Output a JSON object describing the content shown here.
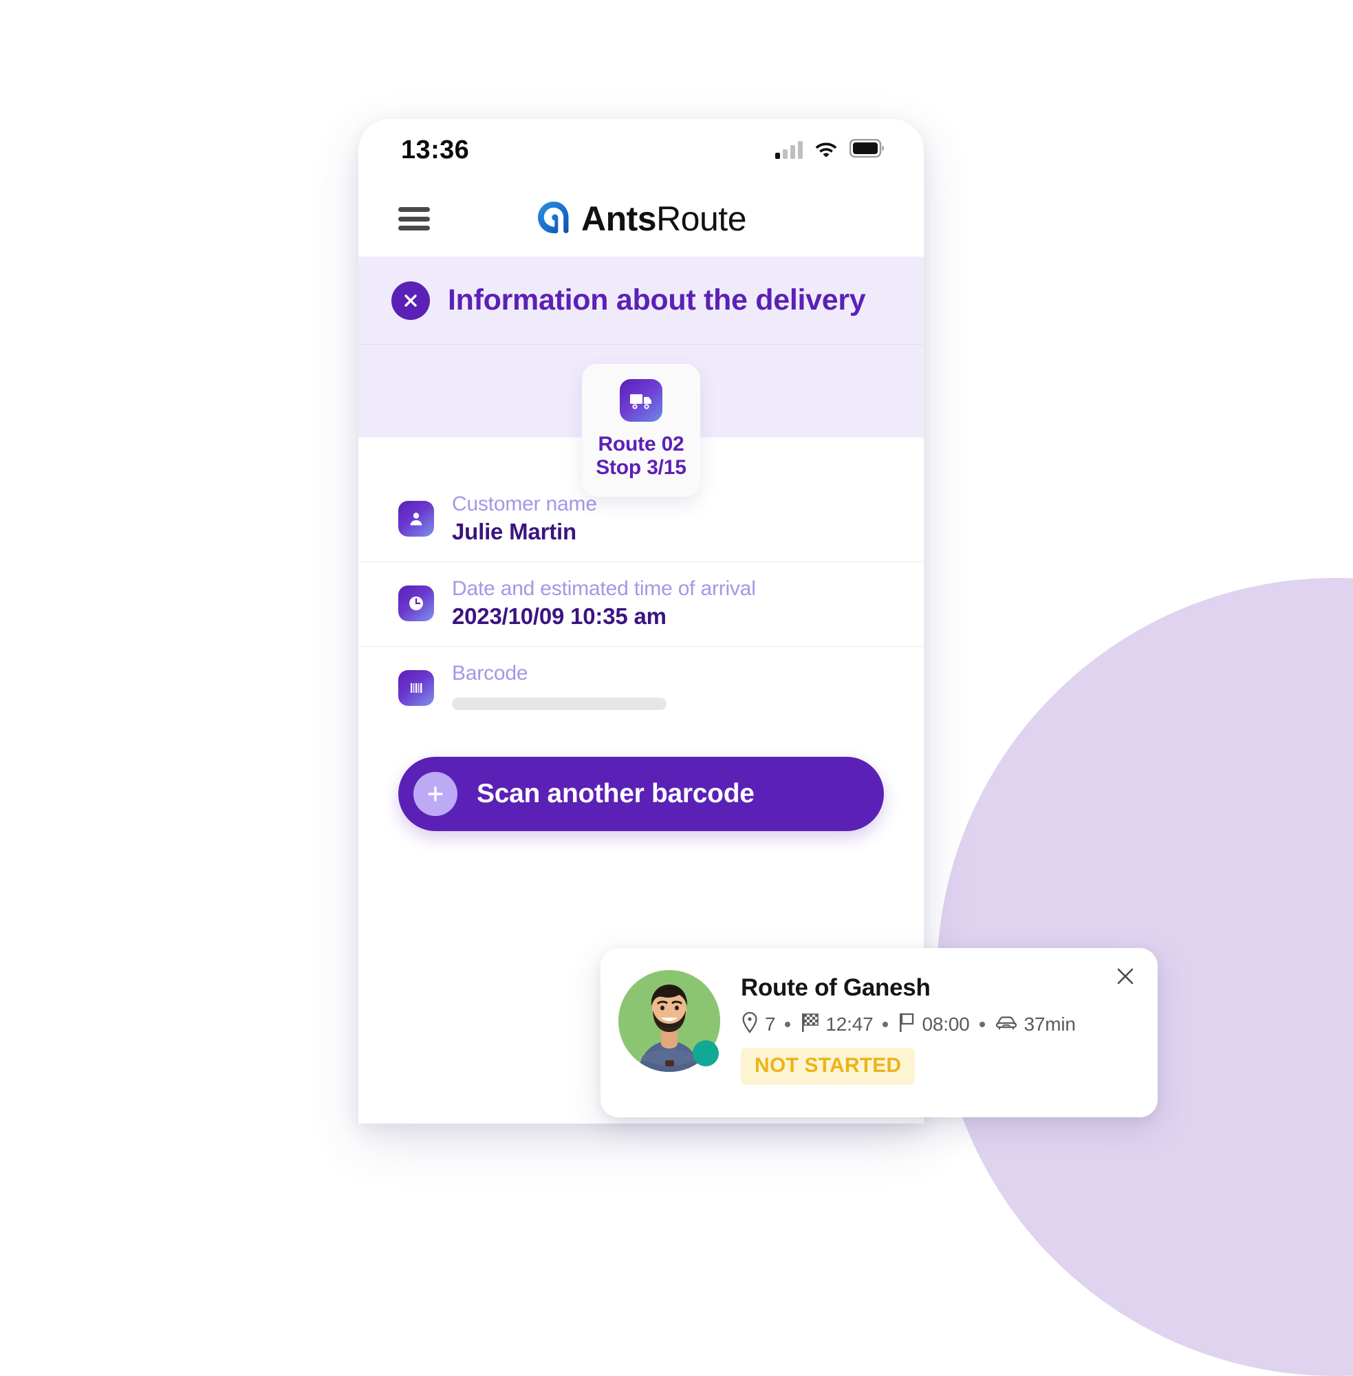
{
  "colors": {
    "brand_purple": "#5b21b6",
    "lavender_bg": "#f0ebfb",
    "label_purple": "#a596e8",
    "value_purple": "#3b1480",
    "blob_purple": "#dfd3f0",
    "badge_bg": "#fdf5d2",
    "badge_text": "#edb21a",
    "avatar_bg": "#8cc572",
    "status_dot": "#11a896",
    "logo_blue": "#1a73d4"
  },
  "phone": {
    "status_bar": {
      "time": "13:36",
      "icons": [
        "signal-icon",
        "wifi-icon",
        "battery-icon"
      ]
    },
    "app_bar": {
      "menu_icon": "hamburger-menu-icon",
      "logo_icon": "antsroute-logo-icon",
      "brand_bold": "Ants",
      "brand_light": "Route"
    },
    "section_header": {
      "close_icon": "close-icon",
      "title": "Information about the delivery"
    },
    "route_chip": {
      "icon": "delivery-truck-icon",
      "line1": "Route 02",
      "line2": "Stop 3/15"
    },
    "info_rows": [
      {
        "icon": "person-badge-icon",
        "label": "Customer name",
        "value": "Julie Martin",
        "skeleton": false
      },
      {
        "icon": "clock-icon",
        "label": "Date and estimated time of arrival",
        "value": "2023/10/09 10:35 am",
        "skeleton": false
      },
      {
        "icon": "barcode-icon",
        "label": "Barcode",
        "value": "",
        "skeleton": true
      }
    ],
    "cta": {
      "icon": "plus-icon",
      "label": "Scan another barcode"
    }
  },
  "route_card": {
    "avatar_icon": "driver-avatar",
    "status_dot": "online-status-dot",
    "title": "Route of Ganesh",
    "close_icon": "close-icon",
    "stats": [
      {
        "icon": "map-pin-icon",
        "text": "7"
      },
      {
        "icon": "checkered-flag-icon",
        "text": "12:47"
      },
      {
        "icon": "flag-icon",
        "text": "08:00"
      },
      {
        "icon": "car-icon",
        "text": "37min"
      }
    ],
    "status_label": "NOT STARTED"
  }
}
